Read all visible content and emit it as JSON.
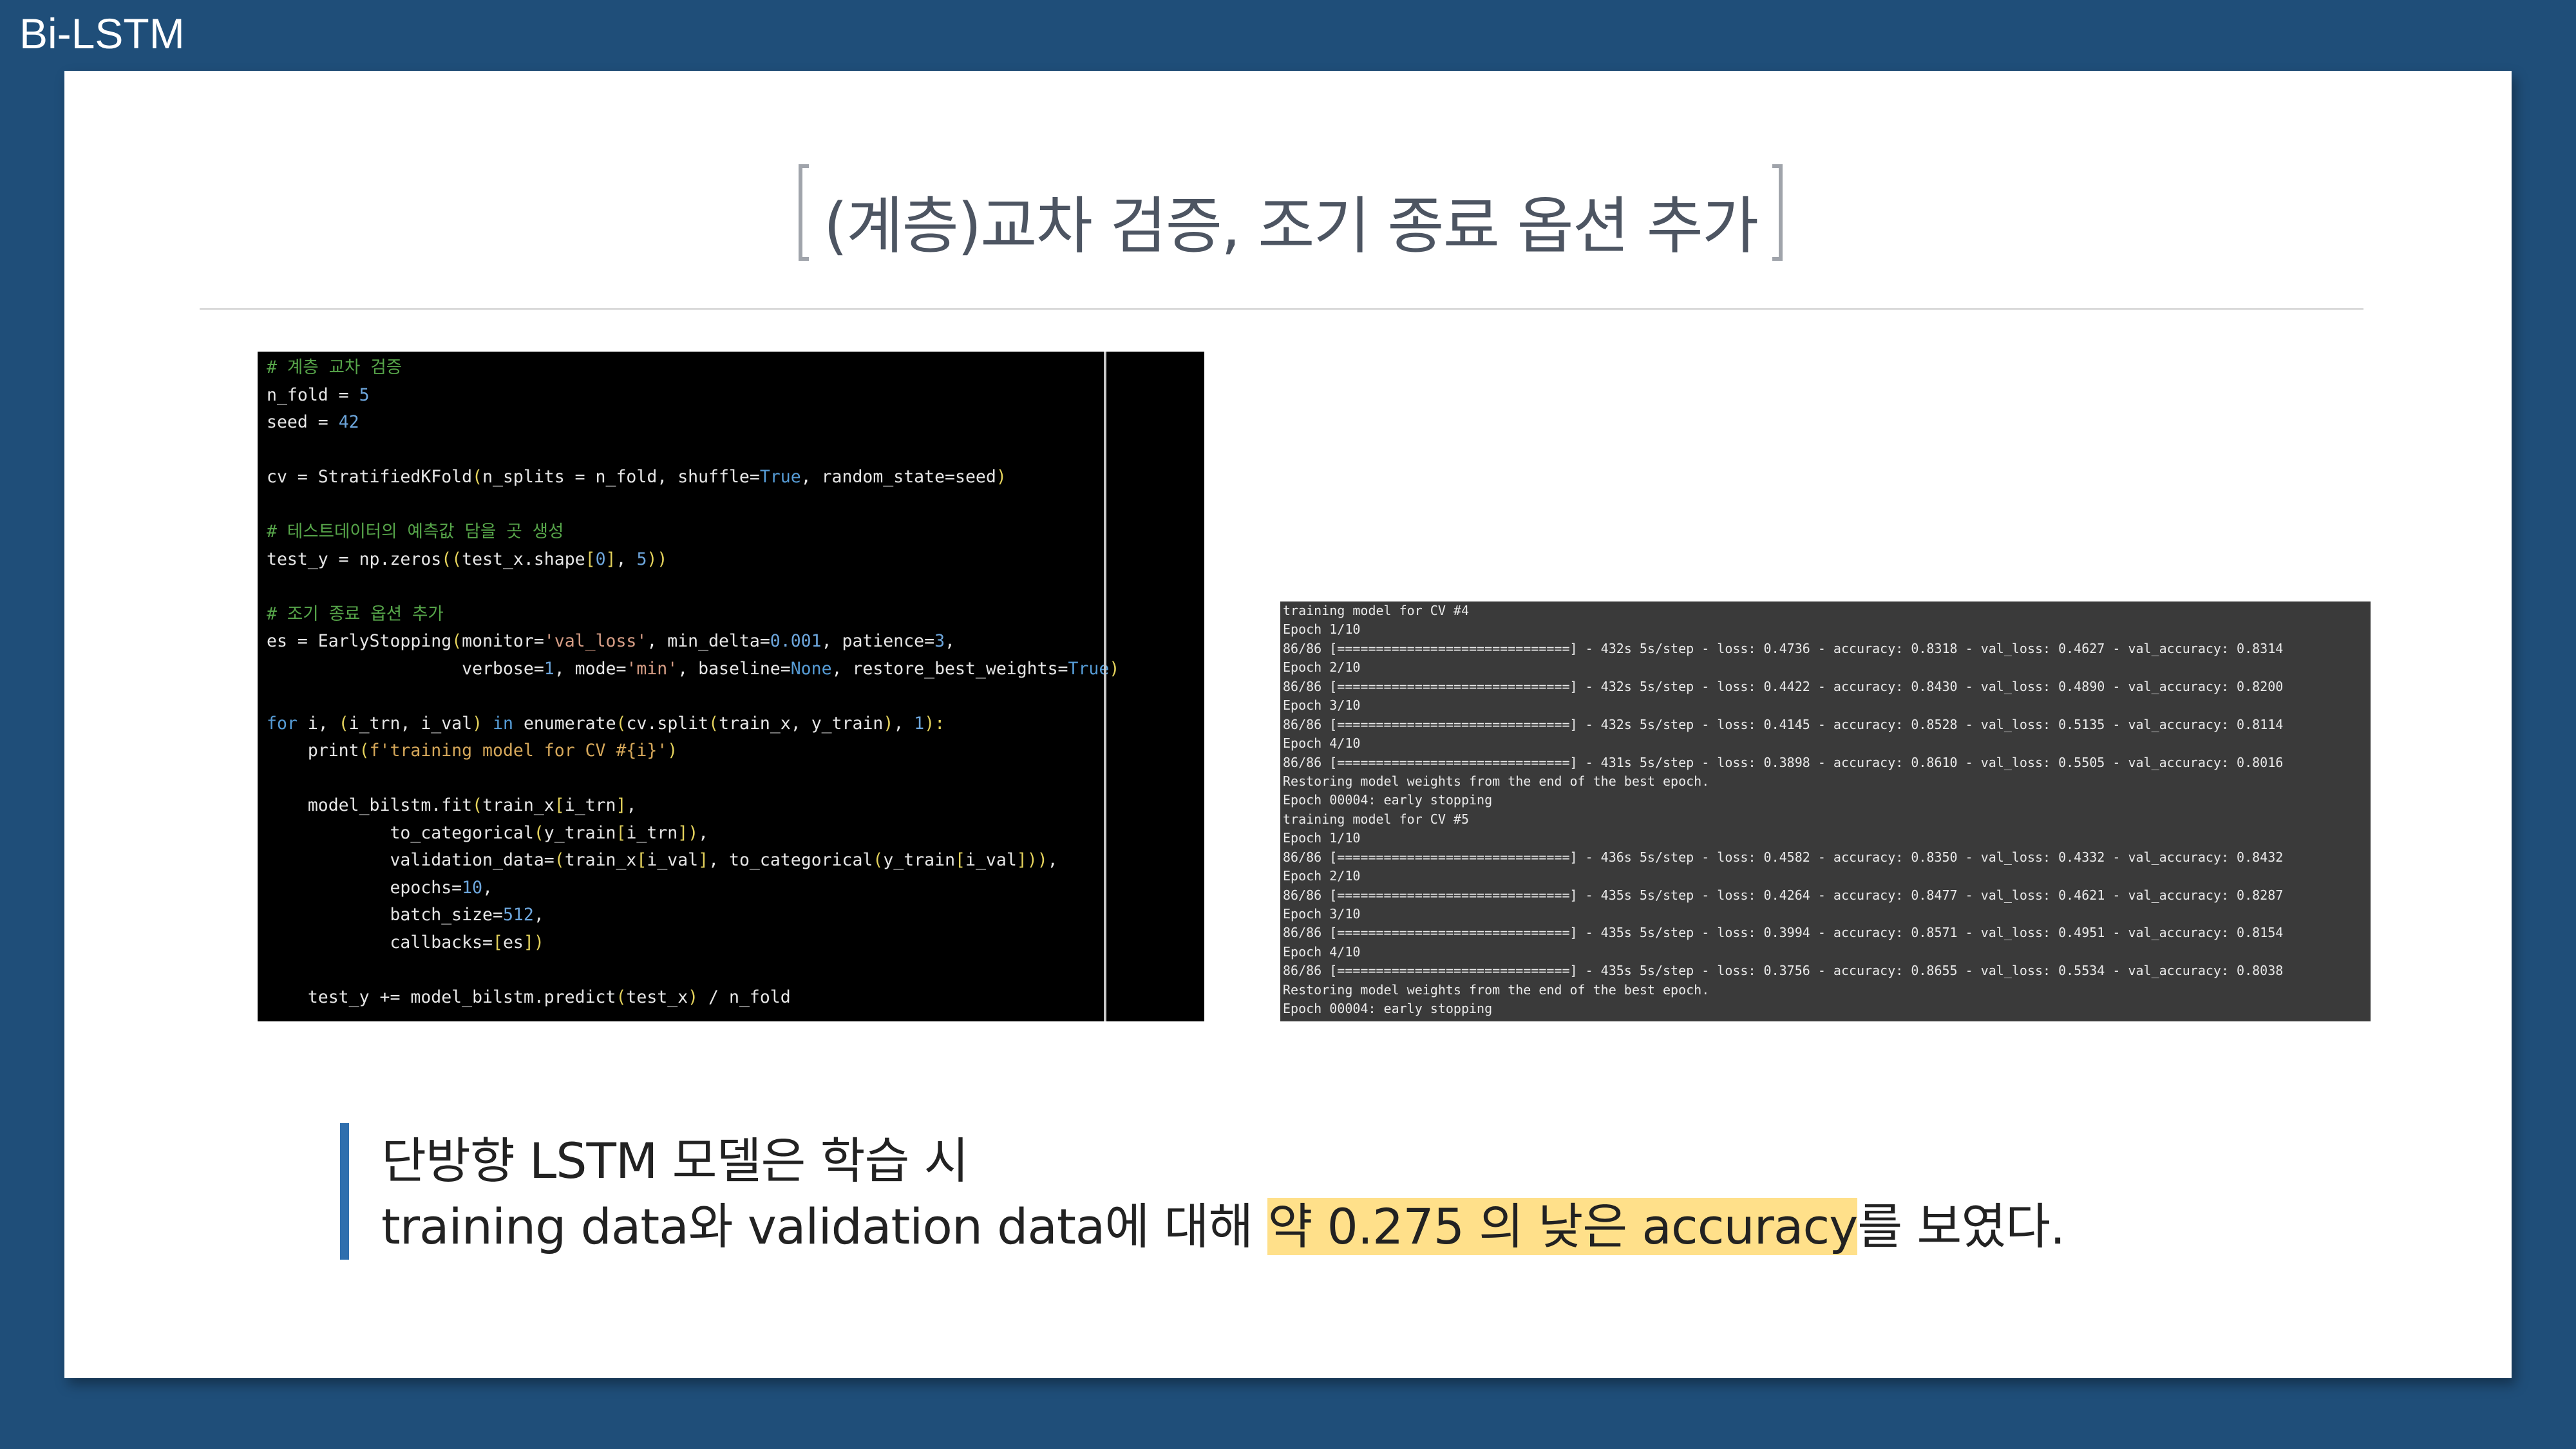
{
  "slide": {
    "label": "Bi-LSTM",
    "title": "(계층)교차 검증, 조기 종료 옵션 추가"
  },
  "code": {
    "lines": [
      [
        {
          "t": "# 계층 교차 검증",
          "c": "cm"
        }
      ],
      [
        {
          "t": "n_fold = "
        },
        {
          "t": "5",
          "c": "num"
        }
      ],
      [
        {
          "t": "seed = "
        },
        {
          "t": "42",
          "c": "num"
        }
      ],
      [
        {
          "t": ""
        }
      ],
      [
        {
          "t": "cv = StratifiedKFold"
        },
        {
          "t": "(",
          "c": "brk"
        },
        {
          "t": "n_splits = n_fold, shuffle="
        },
        {
          "t": "True",
          "c": "kw"
        },
        {
          "t": ", random_state=seed"
        },
        {
          "t": ")",
          "c": "brk"
        }
      ],
      [
        {
          "t": ""
        }
      ],
      [
        {
          "t": "# 테스트데이터의 예측값 담을 곳 생성",
          "c": "cm"
        }
      ],
      [
        {
          "t": "test_y = np.zeros"
        },
        {
          "t": "((",
          "c": "brk"
        },
        {
          "t": "test_x.shape"
        },
        {
          "t": "[",
          "c": "brk"
        },
        {
          "t": "0",
          "c": "num"
        },
        {
          "t": "]",
          "c": "brk"
        },
        {
          "t": ", "
        },
        {
          "t": "5",
          "c": "num"
        },
        {
          "t": "))",
          "c": "brk"
        }
      ],
      [
        {
          "t": ""
        }
      ],
      [
        {
          "t": "# 조기 종료 옵션 추가",
          "c": "cm"
        }
      ],
      [
        {
          "t": "es = EarlyStopping"
        },
        {
          "t": "(",
          "c": "brk"
        },
        {
          "t": "monitor="
        },
        {
          "t": "'val_loss'",
          "c": "str"
        },
        {
          "t": ", min_delta="
        },
        {
          "t": "0.001",
          "c": "num"
        },
        {
          "t": ", patience="
        },
        {
          "t": "3",
          "c": "num"
        },
        {
          "t": ","
        }
      ],
      [
        {
          "t": "                   verbose="
        },
        {
          "t": "1",
          "c": "num"
        },
        {
          "t": ", mode="
        },
        {
          "t": "'min'",
          "c": "str"
        },
        {
          "t": ", baseline="
        },
        {
          "t": "None",
          "c": "kw"
        },
        {
          "t": ", restore_best_weights="
        },
        {
          "t": "True",
          "c": "kw"
        },
        {
          "t": ")",
          "c": "brk"
        }
      ],
      [
        {
          "t": ""
        }
      ],
      [
        {
          "t": "for",
          "c": "kw"
        },
        {
          "t": " i, "
        },
        {
          "t": "(",
          "c": "brk"
        },
        {
          "t": "i_trn, i_val"
        },
        {
          "t": ")",
          "c": "brk"
        },
        {
          "t": " "
        },
        {
          "t": "in",
          "c": "kw"
        },
        {
          "t": " enumerate"
        },
        {
          "t": "(",
          "c": "brk"
        },
        {
          "t": "cv.split"
        },
        {
          "t": "(",
          "c": "brk"
        },
        {
          "t": "train_x, y_train"
        },
        {
          "t": ")",
          "c": "brk"
        },
        {
          "t": ", "
        },
        {
          "t": "1",
          "c": "num"
        },
        {
          "t": "):",
          "c": "brk"
        }
      ],
      [
        {
          "t": "    print"
        },
        {
          "t": "(",
          "c": "brk"
        },
        {
          "t": "f'training model for CV #{i}'",
          "c": "str2"
        },
        {
          "t": ")",
          "c": "brk"
        }
      ],
      [
        {
          "t": ""
        }
      ],
      [
        {
          "t": "    model_bilstm.fit"
        },
        {
          "t": "(",
          "c": "brk"
        },
        {
          "t": "train_x"
        },
        {
          "t": "[",
          "c": "brk"
        },
        {
          "t": "i_trn"
        },
        {
          "t": "]",
          "c": "brk"
        },
        {
          "t": ","
        }
      ],
      [
        {
          "t": "            to_categorical"
        },
        {
          "t": "(",
          "c": "brk"
        },
        {
          "t": "y_train"
        },
        {
          "t": "[",
          "c": "brk"
        },
        {
          "t": "i_trn"
        },
        {
          "t": "])",
          "c": "brk"
        },
        {
          "t": ","
        }
      ],
      [
        {
          "t": "            validation_data="
        },
        {
          "t": "(",
          "c": "brk"
        },
        {
          "t": "train_x"
        },
        {
          "t": "[",
          "c": "brk"
        },
        {
          "t": "i_val"
        },
        {
          "t": "]",
          "c": "brk"
        },
        {
          "t": ", to_categorical"
        },
        {
          "t": "(",
          "c": "brk"
        },
        {
          "t": "y_train"
        },
        {
          "t": "[",
          "c": "brk"
        },
        {
          "t": "i_val"
        },
        {
          "t": "]))",
          "c": "brk"
        },
        {
          "t": ","
        }
      ],
      [
        {
          "t": "            epochs="
        },
        {
          "t": "10",
          "c": "num"
        },
        {
          "t": ","
        }
      ],
      [
        {
          "t": "            batch_size="
        },
        {
          "t": "512",
          "c": "num"
        },
        {
          "t": ","
        }
      ],
      [
        {
          "t": "            callbacks="
        },
        {
          "t": "[",
          "c": "brk"
        },
        {
          "t": "es"
        },
        {
          "t": "])",
          "c": "brk"
        }
      ],
      [
        {
          "t": ""
        }
      ],
      [
        {
          "t": "    test_y += model_bilstm.predict"
        },
        {
          "t": "(",
          "c": "brk"
        },
        {
          "t": "test_x"
        },
        {
          "t": ")",
          "c": "brk"
        },
        {
          "t": " / n_fold"
        }
      ]
    ]
  },
  "terminal": {
    "lines": [
      "training model for CV #4",
      "Epoch 1/10",
      "86/86 [==============================] - 432s 5s/step - loss: 0.4736 - accuracy: 0.8318 - val_loss: 0.4627 - val_accuracy: 0.8314",
      "Epoch 2/10",
      "86/86 [==============================] - 432s 5s/step - loss: 0.4422 - accuracy: 0.8430 - val_loss: 0.4890 - val_accuracy: 0.8200",
      "Epoch 3/10",
      "86/86 [==============================] - 432s 5s/step - loss: 0.4145 - accuracy: 0.8528 - val_loss: 0.5135 - val_accuracy: 0.8114",
      "Epoch 4/10",
      "86/86 [==============================] - 431s 5s/step - loss: 0.3898 - accuracy: 0.8610 - val_loss: 0.5505 - val_accuracy: 0.8016",
      "Restoring model weights from the end of the best epoch.",
      "Epoch 00004: early stopping",
      "training model for CV #5",
      "Epoch 1/10",
      "86/86 [==============================] - 436s 5s/step - loss: 0.4582 - accuracy: 0.8350 - val_loss: 0.4332 - val_accuracy: 0.8432",
      "Epoch 2/10",
      "86/86 [==============================] - 435s 5s/step - loss: 0.4264 - accuracy: 0.8477 - val_loss: 0.4621 - val_accuracy: 0.8287",
      "Epoch 3/10",
      "86/86 [==============================] - 435s 5s/step - loss: 0.3994 - accuracy: 0.8571 - val_loss: 0.4951 - val_accuracy: 0.8154",
      "Epoch 4/10",
      "86/86 [==============================] - 435s 5s/step - loss: 0.3756 - accuracy: 0.8655 - val_loss: 0.5534 - val_accuracy: 0.8038",
      "Restoring model weights from the end of the best epoch.",
      "Epoch 00004: early stopping"
    ]
  },
  "callout": {
    "line1": "단방향 LSTM 모델은 학습 시",
    "line2_prefix": "training data와 validation data에 대해 ",
    "line2_highlight": "약 0.275 의 낮은 accuracy",
    "line2_suffix": "를 보였다."
  },
  "colors": {
    "background": "#1f4e79",
    "panel": "#ffffff",
    "accent_bar": "#2f6fae",
    "highlight": "#ffe08a",
    "code_bg": "#000000",
    "terminal_bg": "#3a3a3a"
  }
}
